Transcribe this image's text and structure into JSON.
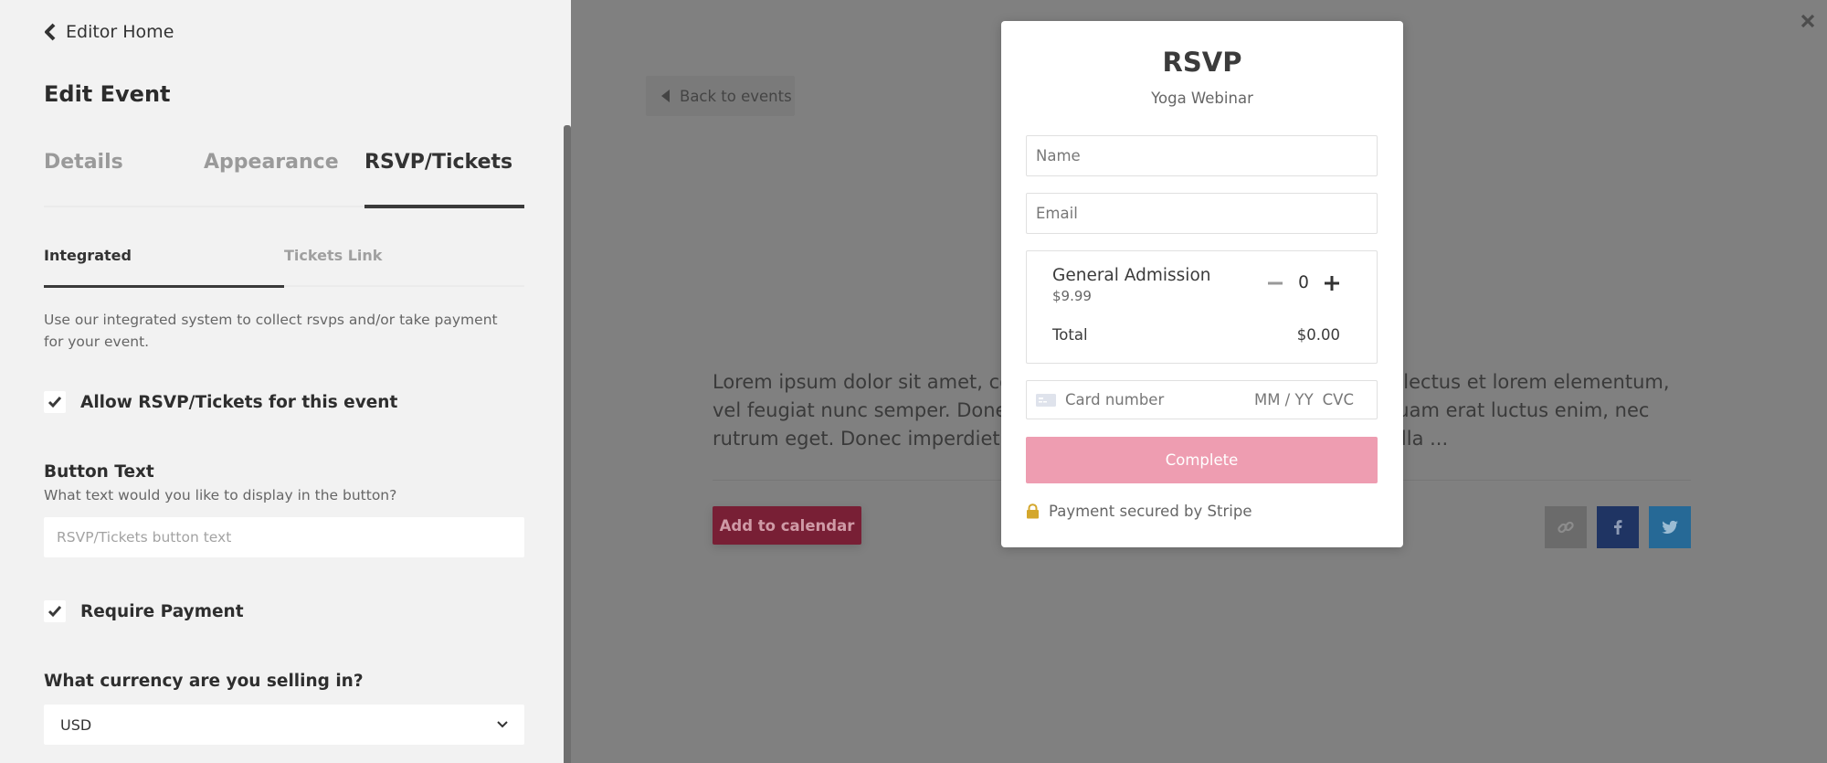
{
  "editor": {
    "back_label": "Editor Home",
    "title": "Edit Event",
    "tabs": [
      {
        "label": "Details",
        "active": false
      },
      {
        "label": "Appearance",
        "active": false
      },
      {
        "label": "RSVP/Tickets",
        "active": true
      }
    ],
    "subtabs": [
      {
        "label": "Integrated",
        "active": true
      },
      {
        "label": "Tickets Link",
        "active": false
      }
    ],
    "intro": "Use our integrated system to collect rsvps and/or take payment for your event.",
    "allow_rsvp": {
      "label": "Allow RSVP/Tickets for this event",
      "checked": true
    },
    "button_text": {
      "label": "Button Text",
      "help": "What text would you like to display in the button?",
      "value": "",
      "placeholder": "RSVP/Tickets button text"
    },
    "require_payment": {
      "label": "Require Payment",
      "checked": true
    },
    "currency": {
      "label": "What currency are you selling in?",
      "selected": "USD"
    }
  },
  "page": {
    "back_label": "Back to events",
    "description": "Lorem ipsum dolor sit amet, consectetur adipiscing elit. Nunc maximus lectus et lorem elementum, vel feugiat nunc semper. Donec egestas, metus vel tincidunt tempor, quam erat luctus enim, nec rutrum eget. Donec imperdiet, mauris eget faucibus malesuada, nisl nulla ...",
    "add_to_calendar": "Add to calendar",
    "share": [
      {
        "icon": "link-icon",
        "color": "#6b6b6b"
      },
      {
        "icon": "facebook-icon",
        "color": "#1f3463"
      },
      {
        "icon": "twitter-icon",
        "color": "#266996"
      }
    ],
    "close_icon": "close-icon"
  },
  "modal": {
    "title": "RSVP",
    "subtitle": "Yoga Webinar",
    "name_placeholder": "Name",
    "email_placeholder": "Email",
    "ticket": {
      "name": "General Admission",
      "price": "$9.99",
      "quantity": "0"
    },
    "total_label": "Total",
    "total_value": "$0.00",
    "card": {
      "number_placeholder": "Card number",
      "expiry_placeholder": "MM / YY",
      "cvc_placeholder": "CVC"
    },
    "complete_label": "Complete",
    "secure_text": "Payment secured by Stripe"
  },
  "colors": {
    "accent_pink": "#ee9db1",
    "calendar_button": "#781f35",
    "facebook": "#1f3463",
    "twitter": "#266996",
    "lock": "#d4a72c"
  }
}
